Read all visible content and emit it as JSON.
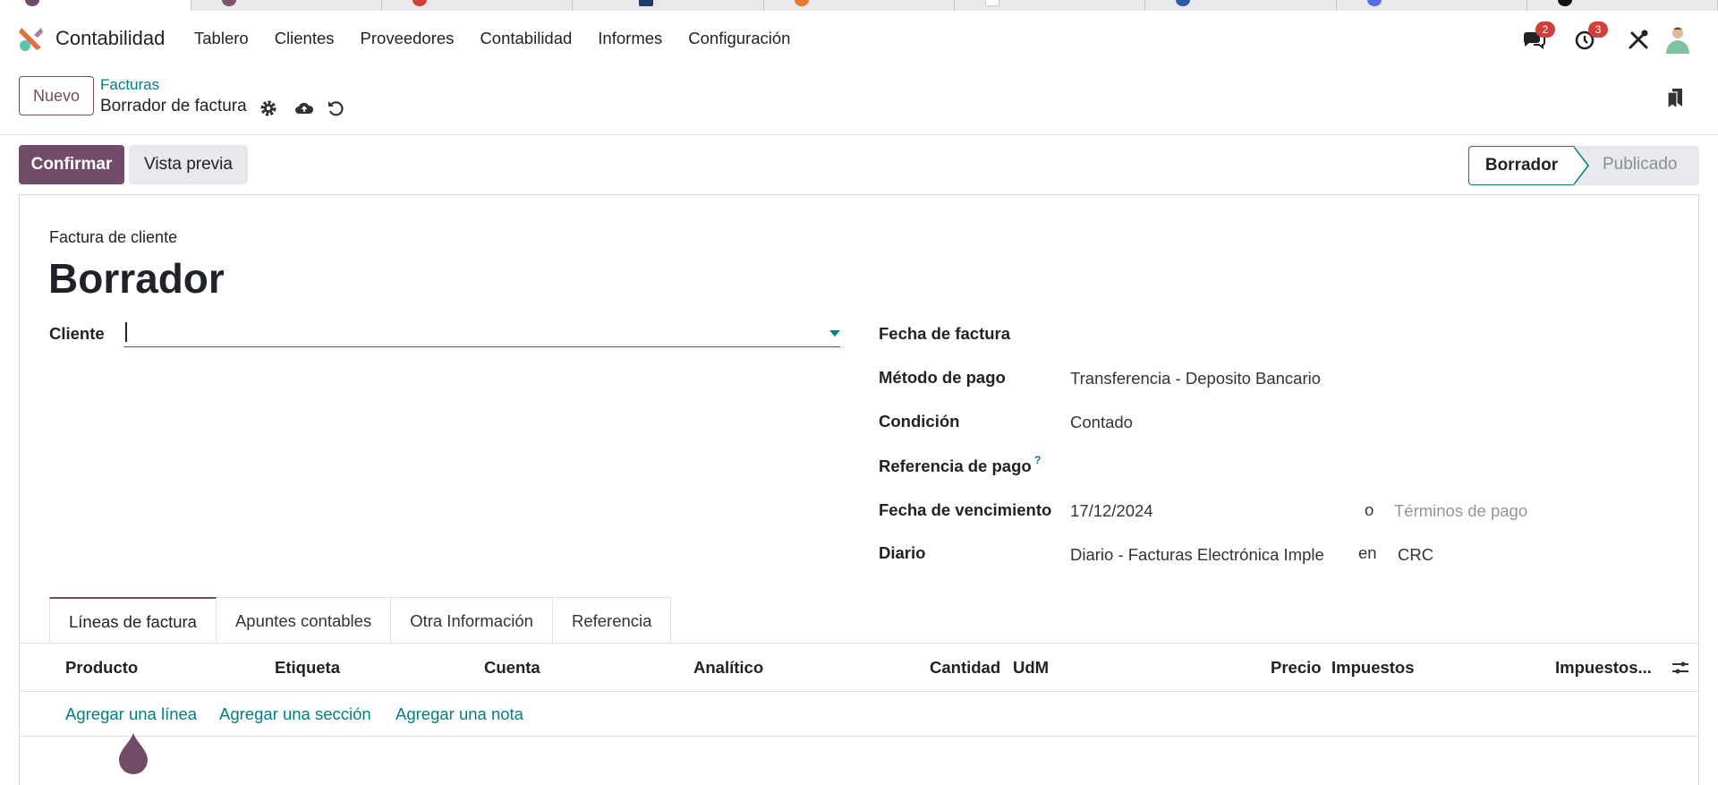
{
  "navbar": {
    "app_name": "Contabilidad",
    "menu": [
      "Tablero",
      "Clientes",
      "Proveedores",
      "Contabilidad",
      "Informes",
      "Configuración"
    ],
    "messages_count": "2",
    "activities_count": "3",
    "icons": [
      "chat-icon",
      "clock-icon",
      "tools-icon",
      "avatar"
    ]
  },
  "control_panel": {
    "new_button": "Nuevo",
    "breadcrumb_parent": "Facturas",
    "breadcrumb_current": "Borrador de factura",
    "icons": [
      "gear-icon",
      "cloud-upload-icon",
      "undo-icon",
      "bookmark-icon"
    ]
  },
  "actions": {
    "confirm": "Confirmar",
    "preview": "Vista previa"
  },
  "statusbar": {
    "current": "Borrador",
    "next": "Publicado"
  },
  "form": {
    "doc_type": "Factura de cliente",
    "title": "Borrador",
    "client_label": "Cliente",
    "client_value": "",
    "invoice_date_label": "Fecha de factura",
    "invoice_date_value": "",
    "payment_method_label": "Método de pago",
    "payment_method_value": "Transferencia - Deposito Bancario",
    "condition_label": "Condición",
    "condition_value": "Contado",
    "payment_ref_label": "Referencia de pago",
    "payment_ref_help": "?",
    "due_date_label": "Fecha de vencimiento",
    "due_date_value": "17/12/2024",
    "or_text": "o",
    "payment_terms_placeholder": "Términos de pago",
    "journal_label": "Diario",
    "journal_value": "Diario - Facturas Electrónica Imple",
    "in_text": "en",
    "currency_value": "CRC"
  },
  "tabs": [
    "Líneas de factura",
    "Apuntes contables",
    "Otra Información",
    "Referencia"
  ],
  "table": {
    "columns": [
      "Producto",
      "Etiqueta",
      "Cuenta",
      "Analítico",
      "Cantidad",
      "UdM",
      "Precio",
      "Impuestos",
      "Impuestos..."
    ],
    "add_line": "Agregar una línea",
    "add_section": "Agregar una sección",
    "add_note": "Agregar una nota"
  },
  "colors": {
    "brand": "#714b67",
    "accent": "#017e84",
    "badge": "#d23f3a"
  }
}
